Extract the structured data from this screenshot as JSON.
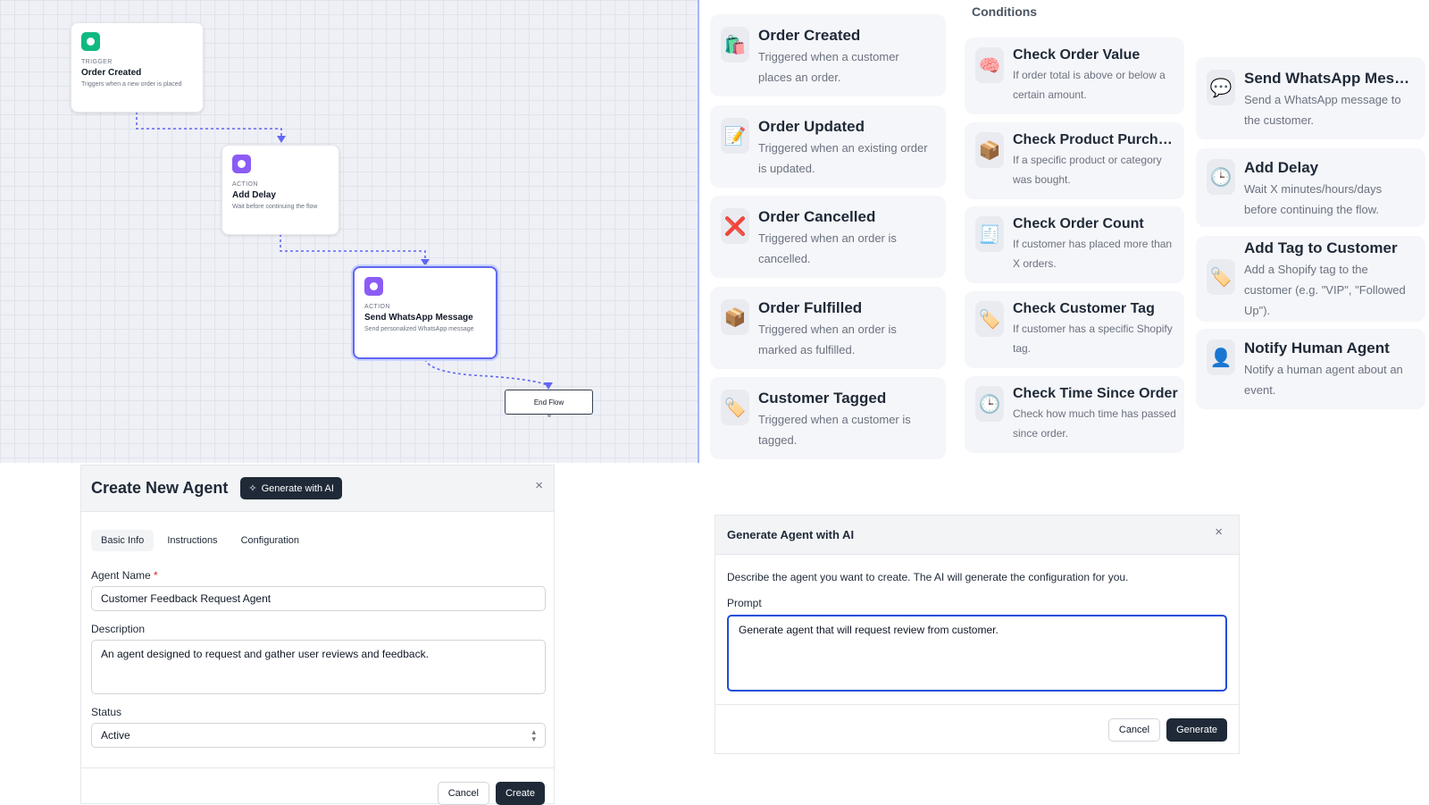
{
  "flow": {
    "nodes": [
      {
        "kind": "TRIGGER",
        "title": "Order Created",
        "desc": "Triggers when a new order is placed",
        "color": "#10b981"
      },
      {
        "kind": "ACTION",
        "title": "Add Delay",
        "desc": "Wait before continuing the flow",
        "color": "#8b5cf6"
      },
      {
        "kind": "ACTION",
        "title": "Send WhatsApp Message",
        "desc": "Send personalized WhatsApp message",
        "color": "#8b5cf6"
      }
    ],
    "end_label": "End Flow",
    "edge_color": "#6366f1"
  },
  "palette": {
    "conditions_title": "Conditions",
    "triggers": [
      {
        "icon": "shopping-bags-icon",
        "glyph": "🛍️",
        "title": "Order Created",
        "desc": "Triggered when a customer places an order."
      },
      {
        "icon": "memo-icon",
        "glyph": "📝",
        "title": "Order Updated",
        "desc": "Triggered when an existing order is updated."
      },
      {
        "icon": "cross-mark-icon",
        "glyph": "❌",
        "title": "Order Cancelled",
        "desc": "Triggered when an order is cancelled."
      },
      {
        "icon": "package-icon",
        "glyph": "📦",
        "title": "Order Fulfilled",
        "desc": "Triggered when an order is marked as fulfilled."
      },
      {
        "icon": "tag-icon",
        "glyph": "🏷️",
        "title": "Customer Tagged",
        "desc": "Triggered when a customer is tagged."
      }
    ],
    "conditions": [
      {
        "icon": "brain-icon",
        "glyph": "🧠",
        "title": "Check Order Value",
        "desc": "If order total is above or below a certain amount."
      },
      {
        "icon": "package-icon",
        "glyph": "📦",
        "title": "Check Product Purcha...",
        "desc": "If a specific product or category was bought."
      },
      {
        "icon": "receipt-icon",
        "glyph": "🧾",
        "title": "Check Order Count",
        "desc": "If customer has placed more than X orders."
      },
      {
        "icon": "tag-icon",
        "glyph": "🏷️",
        "title": "Check Customer Tag",
        "desc": "If customer has a specific Shopify tag."
      },
      {
        "icon": "clock-icon",
        "glyph": "🕒",
        "title": "Check Time Since Order",
        "desc": "Check how much time has passed since order."
      }
    ],
    "actions": [
      {
        "icon": "speech-bubble-icon",
        "glyph": "💬",
        "title": "Send WhatsApp Mess...",
        "desc": "Send a WhatsApp message to the customer."
      },
      {
        "icon": "clock-icon",
        "glyph": "🕒",
        "title": "Add Delay",
        "desc": "Wait X minutes/hours/days before continuing the flow."
      },
      {
        "icon": "tag-icon",
        "glyph": "🏷️",
        "title": "Add Tag to Customer",
        "desc": "Add a Shopify tag to the customer (e.g. \"VIP\", \"Followed Up\")."
      },
      {
        "icon": "person-icon",
        "glyph": "👤",
        "title": "Notify Human Agent",
        "desc": "Notify a human agent about an event."
      }
    ]
  },
  "create_dialog": {
    "title": "Create New Agent",
    "ai_button": "Generate with AI",
    "close": "×",
    "tabs": [
      "Basic Info",
      "Instructions",
      "Configuration"
    ],
    "name_label": "Agent Name",
    "name_required": "*",
    "name_value": "Customer Feedback Request Agent",
    "desc_label": "Description",
    "desc_value": "An agent designed to request and gather user reviews and feedback.",
    "status_label": "Status",
    "status_value": "Active",
    "cancel": "Cancel",
    "create": "Create"
  },
  "ai_dialog": {
    "title": "Generate Agent with AI",
    "close": "×",
    "intro": "Describe the agent you want to create. The AI will generate the configuration for you.",
    "prompt_label": "Prompt",
    "prompt_value": "Generate agent that will request review from customer.",
    "cancel": "Cancel",
    "generate": "Generate"
  }
}
